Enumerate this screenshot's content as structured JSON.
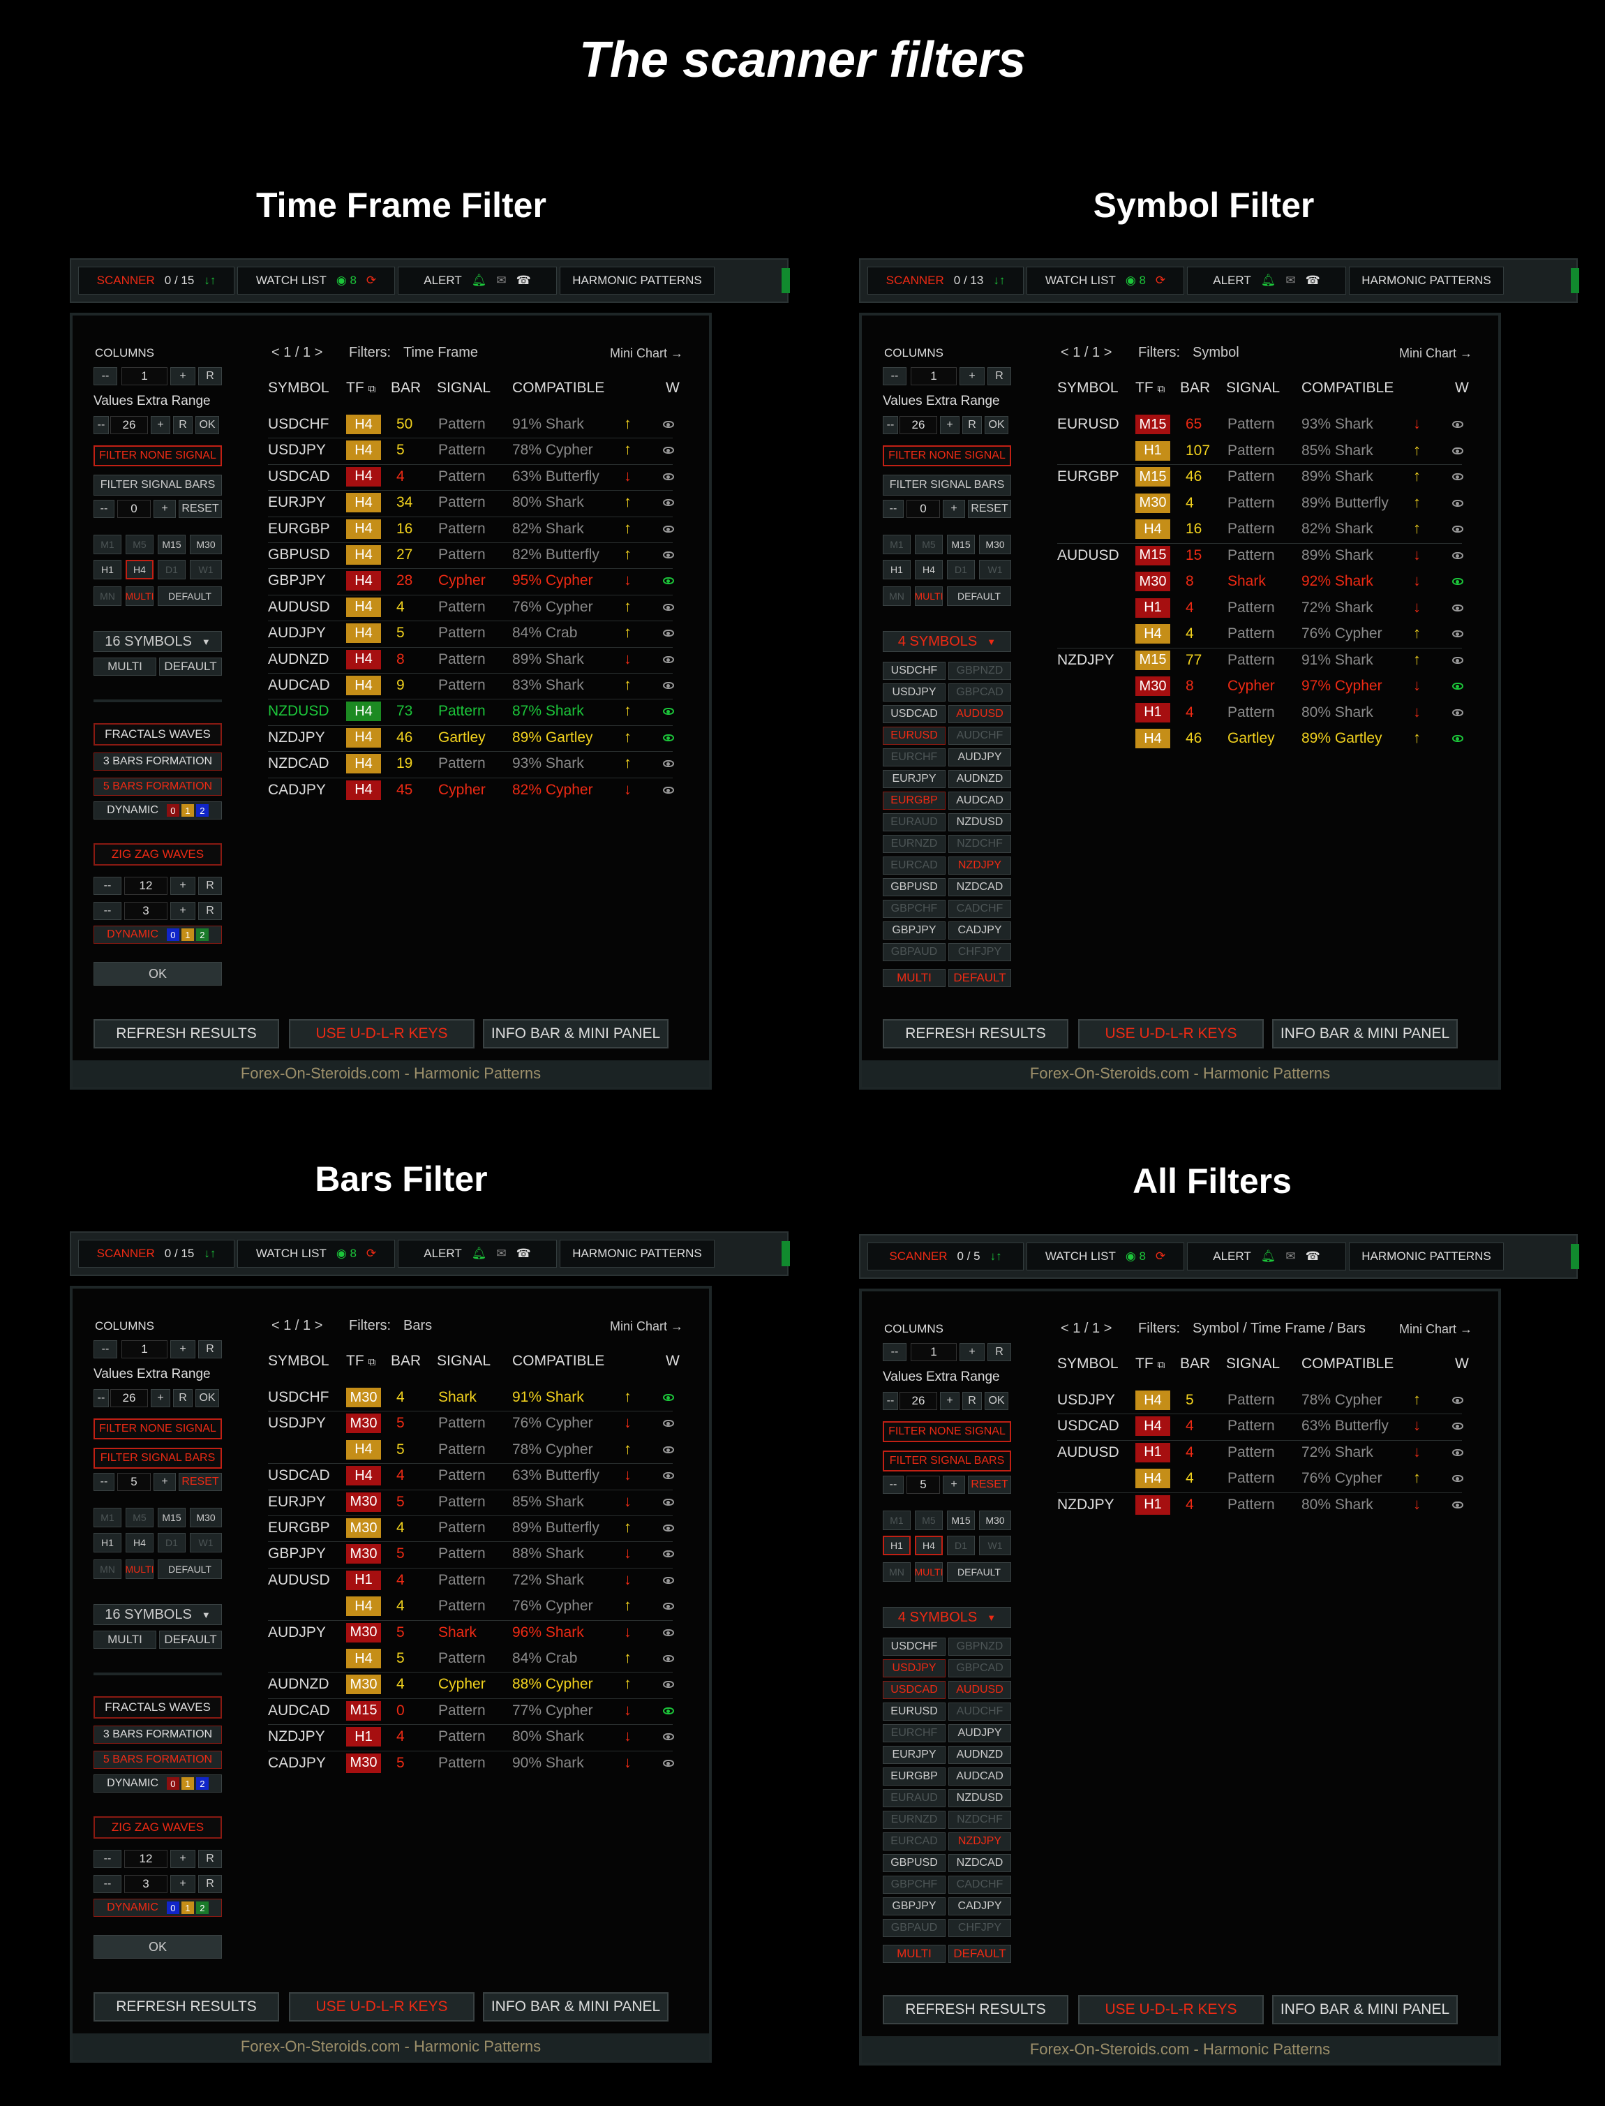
{
  "title": "The scanner filters",
  "common": {
    "scanner": "SCANNER",
    "watchlist": "WATCH LIST",
    "watchcount": "8",
    "alert": "ALERT",
    "harmonic": "HARMONIC PATTERNS",
    "columns": "COLUMNS",
    "col_value": "1",
    "minus": "--",
    "plus": "+",
    "r": "R",
    "ok": "OK",
    "extra_range": "Values Extra Range",
    "extra_value": "26",
    "filter_none": "FILTER NONE SIGNAL",
    "filter_bars": "FILTER SIGNAL BARS",
    "reset": "RESET",
    "tfs": [
      "M1",
      "M5",
      "M15",
      "M30",
      "H1",
      "H4",
      "D1",
      "W1",
      "MN",
      "MULTI",
      "DEFAULT"
    ],
    "multi": "MULTI",
    "default": "DEFAULT",
    "fractals": "FRACTALS WAVES",
    "bars3": "3 BARS FORMATION",
    "bars5": "5 BARS FORMATION",
    "dynamic": "DYNAMIC",
    "d0": "0",
    "d1": "1",
    "d2": "2",
    "zigzag": "ZIG ZAG WAVES",
    "zz1": "12",
    "zz2": "3",
    "okbtn": "OK",
    "page": "<  1 / 1  >",
    "filters_prefix": "Filters:",
    "minichart": "Mini Chart  →",
    "h_symbol": "SYMBOL",
    "h_tf": "TF",
    "h_bar": "BAR",
    "h_signal": "SIGNAL",
    "h_comp": "COMPATIBLE",
    "h_w": "W",
    "refresh": "REFRESH RESULTS",
    "keys": "USE  U-D-L-R  KEYS",
    "info": "INFO BAR & MINI PANEL",
    "footer": "Forex-On-Steroids.com - Harmonic Patterns",
    "symlist": [
      [
        "USDCHF",
        "GBPNZD"
      ],
      [
        "USDJPY",
        "GBPCAD"
      ],
      [
        "USDCAD",
        "AUDUSD"
      ],
      [
        "EURUSD",
        "AUDCHF"
      ],
      [
        "EURCHF",
        "AUDJPY"
      ],
      [
        "EURJPY",
        "AUDNZD"
      ],
      [
        "EURGBP",
        "AUDCAD"
      ],
      [
        "EURAUD",
        "NZDUSD"
      ],
      [
        "EURNZD",
        "NZDCHF"
      ],
      [
        "EURCAD",
        "NZDJPY"
      ],
      [
        "GBPUSD",
        "NZDCAD"
      ],
      [
        "GBPCHF",
        "CADCHF"
      ],
      [
        "GBPJPY",
        "CADJPY"
      ],
      [
        "GBPAUD",
        "CHFJPY"
      ]
    ]
  },
  "panels": [
    {
      "title": "Time Frame Filter",
      "count": "0 / 15",
      "filter": "Time Frame",
      "symbols_label": "16  SYMBOLS",
      "bars_value": "0",
      "rows": [
        [
          "USDCHF",
          "H4",
          "o",
          "50",
          "Pattern",
          "91% Shark",
          "u",
          ""
        ],
        [
          "USDJPY",
          "H4",
          "o",
          "5",
          "Pattern",
          "78% Cypher",
          "u",
          ""
        ],
        [
          "USDCAD",
          "H4",
          "r",
          "4",
          "Pattern",
          "63% Butterfly",
          "d",
          ""
        ],
        [
          "EURJPY",
          "H4",
          "o",
          "34",
          "Pattern",
          "80% Shark",
          "u",
          ""
        ],
        [
          "EURGBP",
          "H4",
          "o",
          "16",
          "Pattern",
          "82% Shark",
          "u",
          ""
        ],
        [
          "GBPUSD",
          "H4",
          "o",
          "27",
          "Pattern",
          "82% Butterfly",
          "u",
          ""
        ],
        [
          "GBPJPY",
          "H4",
          "r",
          "28",
          "Cypher",
          "95% Cypher",
          "d",
          "red"
        ],
        [
          "AUDUSD",
          "H4",
          "o",
          "4",
          "Pattern",
          "76% Cypher",
          "u",
          ""
        ],
        [
          "AUDJPY",
          "H4",
          "o",
          "5",
          "Pattern",
          "84% Crab",
          "u",
          ""
        ],
        [
          "AUDNZD",
          "H4",
          "r",
          "8",
          "Pattern",
          "89% Shark",
          "d",
          ""
        ],
        [
          "AUDCAD",
          "H4",
          "o",
          "9",
          "Pattern",
          "83% Shark",
          "u",
          ""
        ],
        [
          "NZDUSD",
          "H4",
          "g",
          "73",
          "Pattern",
          "87% Shark",
          "u",
          "grn"
        ],
        [
          "NZDJPY",
          "H4",
          "o",
          "46",
          "Gartley",
          "89% Gartley",
          "u",
          "yel"
        ],
        [
          "NZDCAD",
          "H4",
          "o",
          "19",
          "Pattern",
          "93% Shark",
          "u",
          ""
        ],
        [
          "CADJPY",
          "H4",
          "r",
          "45",
          "Cypher",
          "82% Cypher",
          "d",
          "red"
        ]
      ]
    },
    {
      "title": "Symbol Filter",
      "count": "0 / 13",
      "filter": "Symbol",
      "symbols_label": "4  SYMBOLS",
      "bars_value": "0",
      "rows": [
        [
          "EURUSD",
          "M15",
          "r",
          "65",
          "Pattern",
          "93% Shark",
          "d",
          ""
        ],
        [
          "",
          "H1",
          "o",
          "107",
          "Pattern",
          "85% Shark",
          "u",
          ""
        ],
        [
          "EURGBP",
          "M15",
          "o",
          "46",
          "Pattern",
          "89% Shark",
          "u",
          ""
        ],
        [
          "",
          "M30",
          "o",
          "4",
          "Pattern",
          "89% Butterfly",
          "u",
          ""
        ],
        [
          "",
          "H4",
          "o",
          "16",
          "Pattern",
          "82% Shark",
          "u",
          ""
        ],
        [
          "AUDUSD",
          "M15",
          "r",
          "15",
          "Pattern",
          "89% Shark",
          "d",
          ""
        ],
        [
          "",
          "M30",
          "r",
          "8",
          "Shark",
          "92% Shark",
          "d",
          "red"
        ],
        [
          "",
          "H1",
          "r",
          "4",
          "Pattern",
          "72% Shark",
          "d",
          ""
        ],
        [
          "",
          "H4",
          "o",
          "4",
          "Pattern",
          "76% Cypher",
          "u",
          ""
        ],
        [
          "NZDJPY",
          "M15",
          "o",
          "77",
          "Pattern",
          "91% Shark",
          "u",
          ""
        ],
        [
          "",
          "M30",
          "r",
          "8",
          "Cypher",
          "97% Cypher",
          "d",
          "red"
        ],
        [
          "",
          "H1",
          "r",
          "4",
          "Pattern",
          "80% Shark",
          "d",
          ""
        ],
        [
          "",
          "H4",
          "o",
          "46",
          "Gartley",
          "89% Gartley",
          "u",
          "yel"
        ]
      ]
    },
    {
      "title": "Bars Filter",
      "count": "0 / 15",
      "filter": "Bars",
      "symbols_label": "16  SYMBOLS",
      "bars_value": "5",
      "rows": [
        [
          "USDCHF",
          "M30",
          "o",
          "4",
          "Shark",
          "91% Shark",
          "u",
          "yel"
        ],
        [
          "USDJPY",
          "M30",
          "r",
          "5",
          "Pattern",
          "76% Cypher",
          "d",
          ""
        ],
        [
          "",
          "H4",
          "o",
          "5",
          "Pattern",
          "78% Cypher",
          "u",
          ""
        ],
        [
          "USDCAD",
          "H4",
          "r",
          "4",
          "Pattern",
          "63% Butterfly",
          "d",
          ""
        ],
        [
          "EURJPY",
          "M30",
          "r",
          "5",
          "Pattern",
          "85% Shark",
          "d",
          ""
        ],
        [
          "EURGBP",
          "M30",
          "o",
          "4",
          "Pattern",
          "89% Butterfly",
          "u",
          ""
        ],
        [
          "GBPJPY",
          "M30",
          "r",
          "5",
          "Pattern",
          "88% Shark",
          "d",
          ""
        ],
        [
          "AUDUSD",
          "H1",
          "r",
          "4",
          "Pattern",
          "72% Shark",
          "d",
          ""
        ],
        [
          "",
          "H4",
          "o",
          "4",
          "Pattern",
          "76% Cypher",
          "u",
          ""
        ],
        [
          "AUDJPY",
          "M30",
          "r",
          "5",
          "Shark",
          "96% Shark",
          "d",
          "red"
        ],
        [
          "",
          "H4",
          "o",
          "5",
          "Pattern",
          "84% Crab",
          "u",
          ""
        ],
        [
          "AUDNZD",
          "M30",
          "o",
          "4",
          "Cypher",
          "88% Cypher",
          "u",
          "yel"
        ],
        [
          "AUDCAD",
          "M15",
          "r",
          "0",
          "Pattern",
          "77% Cypher",
          "d",
          "eyeg"
        ],
        [
          "NZDJPY",
          "H1",
          "r",
          "4",
          "Pattern",
          "80% Shark",
          "d",
          ""
        ],
        [
          "CADJPY",
          "M30",
          "r",
          "5",
          "Pattern",
          "90% Shark",
          "d",
          ""
        ]
      ]
    },
    {
      "title": "All Filters",
      "count": "0 / 5",
      "filter": "Symbol / Time Frame / Bars",
      "symbols_label": "4  SYMBOLS",
      "bars_value": "5",
      "rows": [
        [
          "USDJPY",
          "H4",
          "o",
          "5",
          "Pattern",
          "78% Cypher",
          "u",
          ""
        ],
        [
          "USDCAD",
          "H4",
          "r",
          "4",
          "Pattern",
          "63% Butterfly",
          "d",
          ""
        ],
        [
          "AUDUSD",
          "H1",
          "r",
          "4",
          "Pattern",
          "72% Shark",
          "d",
          ""
        ],
        [
          "",
          "H4",
          "o",
          "4",
          "Pattern",
          "76% Cypher",
          "u",
          ""
        ],
        [
          "NZDJPY",
          "H1",
          "r",
          "4",
          "Pattern",
          "80% Shark",
          "d",
          ""
        ]
      ]
    }
  ]
}
